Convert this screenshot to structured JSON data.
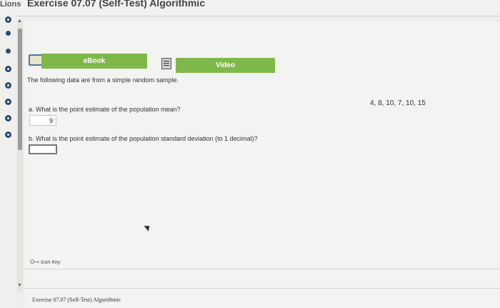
{
  "header": {
    "left_tab": "Lions",
    "title": "Exercise 07.07 (Self-Test) Algorithmic"
  },
  "sidebar": {
    "statuses": [
      "complete",
      "complete",
      "partial",
      "partial",
      "partial",
      "partial",
      "partial"
    ]
  },
  "toolbar": {
    "ebook_label": "eBook",
    "video_label": "Video",
    "book_icon": "book-icon",
    "video_icon": "film-icon"
  },
  "problem": {
    "intro": "The following data are from a simple random sample.",
    "data": "4, 8, 10, 7, 10, 15",
    "question_a": "a. What is the point estimate of the population mean?",
    "answer_a": "9",
    "question_b": "b. What is the point estimate of the population standard deviation (to 1 decimal)?",
    "answer_b": ""
  },
  "footer": {
    "icon_key_label": "Icon Key",
    "title": "Exercise 07.07 (Self-Test) Algorithmic"
  },
  "colors": {
    "button_green": "#7fb84a",
    "status_blue": "#2a4a78"
  }
}
